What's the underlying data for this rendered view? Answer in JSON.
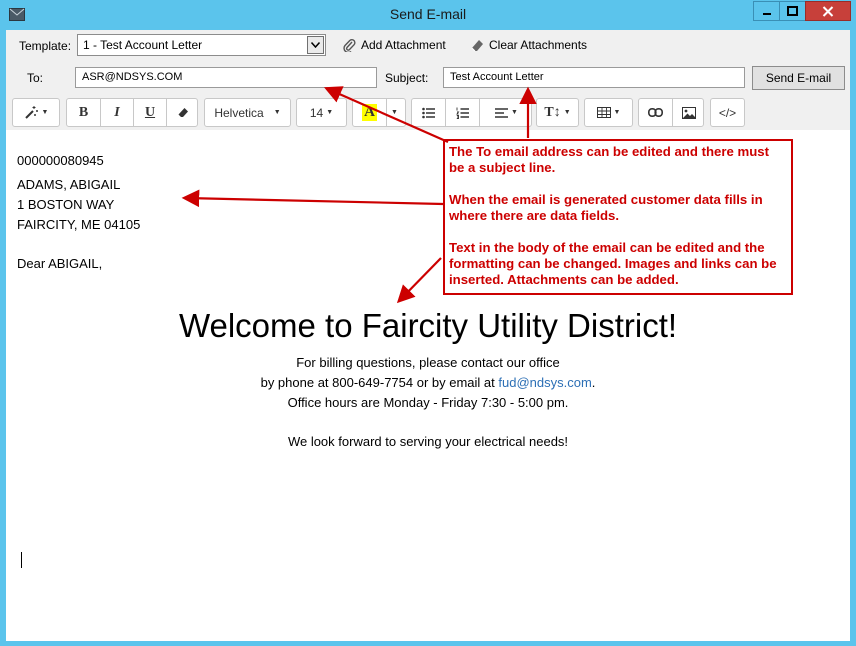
{
  "window": {
    "title": "Send E-mail"
  },
  "header": {
    "template_label": "Template:",
    "template_value": "1 - Test Account Letter",
    "add_attachment": "Add Attachment",
    "clear_attachments": "Clear Attachments",
    "to_label": "To:",
    "to_value": "ASR@NDSYS.COM",
    "subject_label": "Subject:",
    "subject_value": "Test Account Letter",
    "send_label": "Send E-mail"
  },
  "toolbar": {
    "font_name": "Helvetica",
    "font_size": "14",
    "highlight_letter": "A",
    "bold": "B",
    "italic": "I",
    "underline": "U",
    "code_view": "</>",
    "text_height": "T↕",
    "icons": [
      "magic-wand-icon",
      "eraser-icon",
      "bullet-list-icon",
      "numbered-list-icon",
      "align-icon",
      "table-icon",
      "link-icon",
      "image-icon"
    ]
  },
  "body": {
    "account": "000000080945",
    "name": "ADAMS, ABIGAIL",
    "address1": "1 BOSTON WAY",
    "address2": "FAIRCITY, ME 04105",
    "greeting": "Dear ABIGAIL,",
    "heading": "Welcome to Faircity Utility District!",
    "line1": "For billing questions, please contact our office",
    "line2_prefix": "by phone at 800-649-7754 or by email at ",
    "line2_email": "fud@ndsys.com",
    "line2_suffix": ".",
    "line3": "Office hours are Monday - Friday 7:30 - 5:00 pm.",
    "line4": "We look forward to serving your electrical needs!"
  },
  "annotation": {
    "p1": "The To email address can be edited and there must be a subject line.",
    "p2": "When the email is generated customer data fills in where there are data fields.",
    "p3": "Text in the body of the email can be edited and the formatting can be changed.  Images and links can be inserted.  Attachments can be added."
  },
  "colors": {
    "titlebar": "#5bc4ec",
    "close_button": "#c7403a",
    "annotation": "#cc0000",
    "link": "#2c6fb5",
    "highlight": "#ffff00"
  }
}
